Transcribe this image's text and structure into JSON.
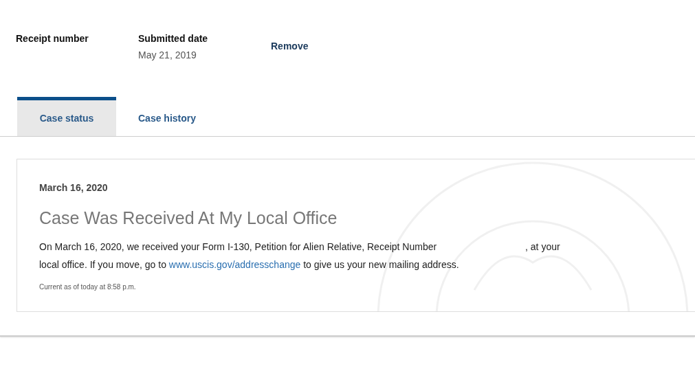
{
  "summary": {
    "fields": [
      {
        "label": "Receipt number"
      },
      {
        "label": "Submitted date",
        "value": "May 21, 2019"
      }
    ],
    "remove_link": "Remove"
  },
  "tabs": [
    {
      "label": "Case status",
      "selected": true
    },
    {
      "label": "Case history",
      "selected": false
    }
  ],
  "status_card": {
    "date": "March 16, 2020",
    "title": "Case Was Received At My Local Office",
    "message": {
      "before": "On March 16, 2020, we received your Form I-130, Petition for Alien Relative, Receipt Number",
      "after_redaction": ", at your local office. If you move, go to",
      "link": "www.uscis.gov/addresschange",
      "after_link": "to give us your new mailing address."
    },
    "updated": "Current as of today at 8:58 p.m."
  }
}
